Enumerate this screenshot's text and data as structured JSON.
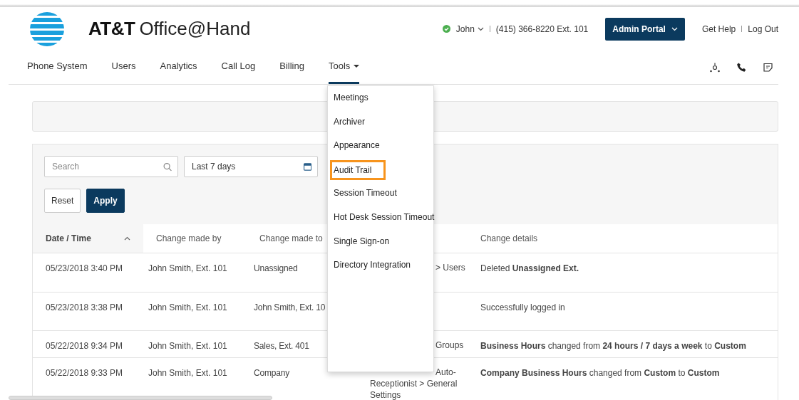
{
  "header": {
    "brand": {
      "company": "AT&T",
      "product": "Office@Hand"
    },
    "user": {
      "name": "John",
      "online": true
    },
    "phone": "(415) 366-8220 Ext. 101",
    "admin_button": "Admin Portal",
    "links": [
      "Get Help",
      "Log Out"
    ]
  },
  "nav": [
    {
      "label": "Phone System",
      "selected": false
    },
    {
      "label": "Users",
      "selected": false
    },
    {
      "label": "Analytics",
      "selected": false
    },
    {
      "label": "Call Log",
      "selected": false
    },
    {
      "label": "Billing",
      "selected": false
    },
    {
      "label": "Tools",
      "selected": true
    }
  ],
  "tools_menu": {
    "open": true,
    "items": [
      {
        "label": "Meetings",
        "highlighted": false
      },
      {
        "label": "Archiver",
        "highlighted": false
      },
      {
        "label": "Appearance",
        "highlighted": false
      },
      {
        "label": "Audit Trail",
        "highlighted": true
      },
      {
        "label": "Session Timeout",
        "highlighted": false
      },
      {
        "label": "Hot Desk Session Timeout",
        "highlighted": false
      },
      {
        "label": "Single Sign-on",
        "highlighted": false
      },
      {
        "label": "Directory Integration",
        "highlighted": false
      }
    ]
  },
  "filters": {
    "search": {
      "placeholder": "Search"
    },
    "date_range": {
      "value": "Last 7 days"
    },
    "buttons": [
      {
        "label": "Reset",
        "kind": "secondary"
      },
      {
        "label": "Apply",
        "kind": "primary"
      }
    ]
  },
  "table": {
    "columns": [
      {
        "label": "Date / Time",
        "sorted": true
      },
      {
        "label": "Change made by",
        "sorted": false
      },
      {
        "label": "Change made to",
        "sorted": false
      },
      {
        "sorted": false
      },
      {
        "label": "Change details",
        "sorted": false
      }
    ],
    "rows": [
      {
        "date_time": "05/23/2018 3:40 PM",
        "changed_by": "John Smith, Ext. 101",
        "changed_to": "Unassigned",
        "column_4": "> Users",
        "details": "Deleted **Unassigned Ext.**"
      },
      {
        "date_time": "05/23/2018 3:38 PM",
        "changed_by": "John Smith, Ext. 101",
        "changed_to": "John Smith, Ext. 10",
        "details": "Successfully logged in"
      },
      {
        "date_time": "05/22/2018 9:34 PM",
        "changed_by": "John Smith, Ext. 101",
        "changed_to": "Sales, Ext. 401",
        "column_4": "Groups",
        "details": "**Business Hours** changed from **24 hours / 7 days a week** to **Custom**"
      },
      {
        "date_time": "05/22/2018 9:33 PM",
        "changed_by": "John Smith, Ext. 101",
        "changed_to": "Company",
        "column_4": "Auto- Receptionist > General Settings",
        "details": "**Company Business Hours** changed from **Custom** to **Custom**"
      }
    ]
  }
}
